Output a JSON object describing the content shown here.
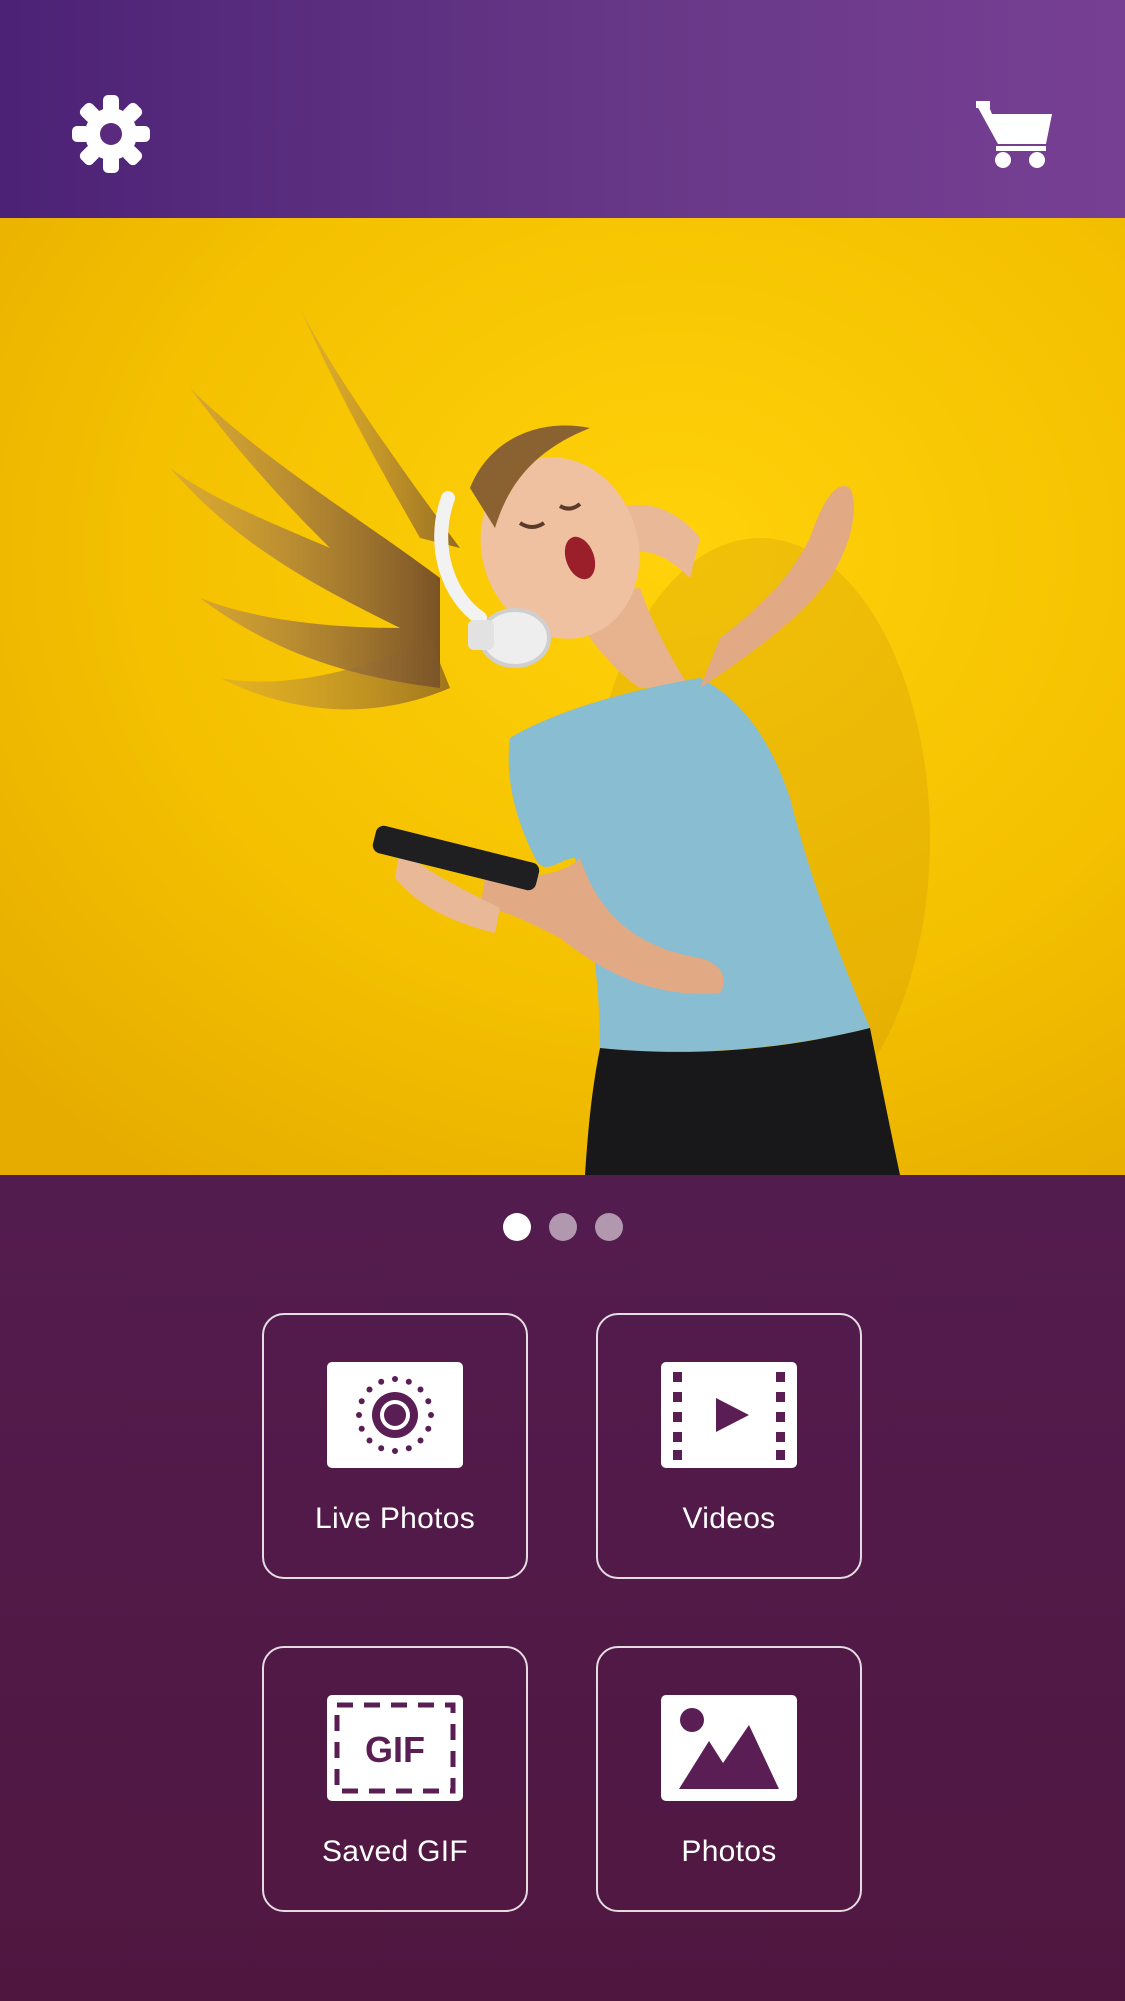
{
  "header": {
    "settings_icon": "gear-icon",
    "cart_icon": "cart-icon"
  },
  "hero": {
    "image": "woman-with-headphones-dancing",
    "background_color": "#f6c200"
  },
  "carousel": {
    "page_count": 3,
    "active_index": 0
  },
  "tiles": [
    {
      "label": "Live Photos",
      "icon": "live-photo-icon"
    },
    {
      "label": "Videos",
      "icon": "video-film-icon"
    },
    {
      "label": "Saved GIF",
      "icon": "gif-icon",
      "icon_text": "GIF"
    },
    {
      "label": "Photos",
      "icon": "photo-landscape-icon"
    }
  ],
  "colors": {
    "header_start": "#4c2276",
    "header_end": "#773f94",
    "body_top": "#5c2474",
    "body_bottom": "#4f1740",
    "tile_border": "#ffffff",
    "accent_icon": "#5a1e55"
  }
}
